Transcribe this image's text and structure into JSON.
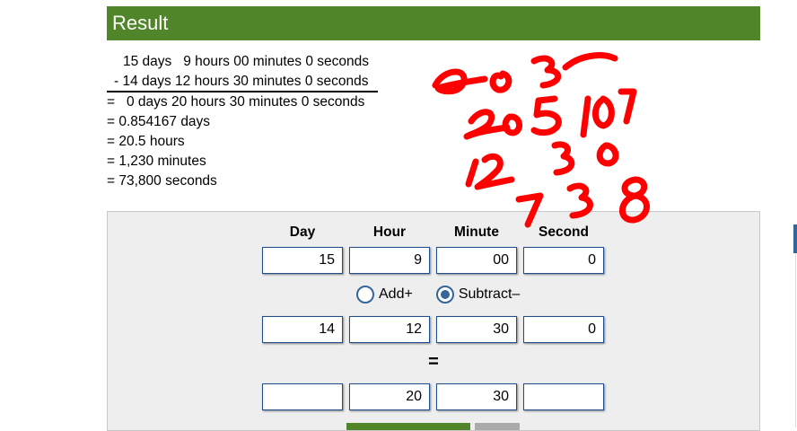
{
  "result": {
    "title": "Result",
    "operand1": "15 days   9 hours 00 minutes 0 seconds",
    "operand2": "- 14 days 12 hours 30 minutes 0 seconds",
    "total": "=   0 days 20 hours 30 minutes 0 seconds",
    "days": "= 0.854167 days",
    "hours": "= 20.5 hours",
    "minutes": "= 1,230 minutes",
    "seconds": "= 73,800 seconds"
  },
  "calculator": {
    "headers": {
      "day": "Day",
      "hour": "Hour",
      "minute": "Minute",
      "second": "Second"
    },
    "row1": {
      "day": "15",
      "hour": "9",
      "minute": "00",
      "second": "0"
    },
    "operation": {
      "add_label": "Add+",
      "subtract_label": "Subtract–",
      "selected": "subtract"
    },
    "row2": {
      "day": "14",
      "hour": "12",
      "minute": "30",
      "second": "0"
    },
    "equals": "=",
    "result_row": {
      "day": "",
      "hour": "20",
      "minute": "30",
      "second": ""
    }
  },
  "colors": {
    "brand_green": "#518529",
    "field_border": "#1f4e8c",
    "annotation_red": "#ff0000"
  },
  "annotation": {
    "handwritten_text": [
      "2030",
      "2050",
      "107",
      "12",
      "30",
      "738"
    ]
  }
}
